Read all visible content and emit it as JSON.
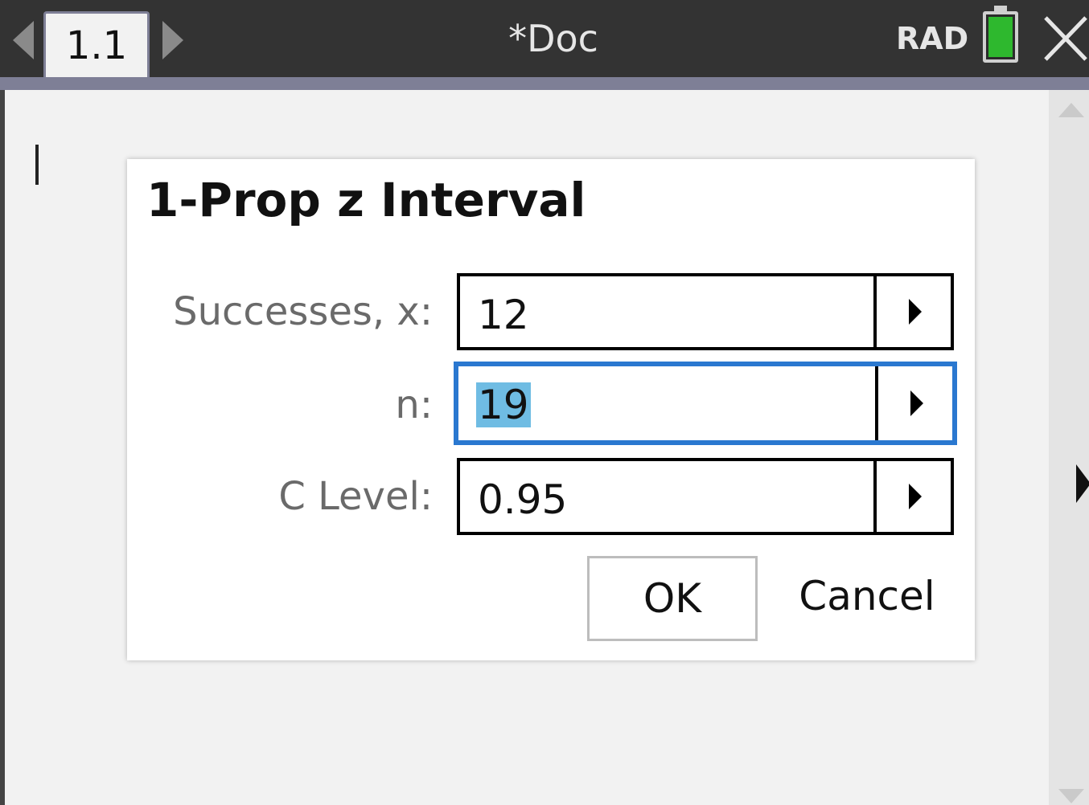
{
  "header": {
    "tab_label": "1.1",
    "doc_title": "*Doc",
    "angle_mode": "RAD",
    "battery_color": "#2eb82e"
  },
  "dialog": {
    "title": "1-Prop z Interval",
    "fields": [
      {
        "label": "Successes, x:",
        "value": "12"
      },
      {
        "label": "n:",
        "value": "19"
      },
      {
        "label": "C Level:",
        "value": "0.95"
      }
    ],
    "ok_label": "OK",
    "cancel_label": "Cancel",
    "accent_color": "#2a78d0",
    "selection_color": "#6fbce3"
  },
  "icons": [
    "prev-page-arrow-icon",
    "next-page-arrow-icon",
    "battery-icon",
    "close-icon",
    "scroll-up-icon",
    "scroll-down-icon",
    "mouse-pointer-icon"
  ]
}
